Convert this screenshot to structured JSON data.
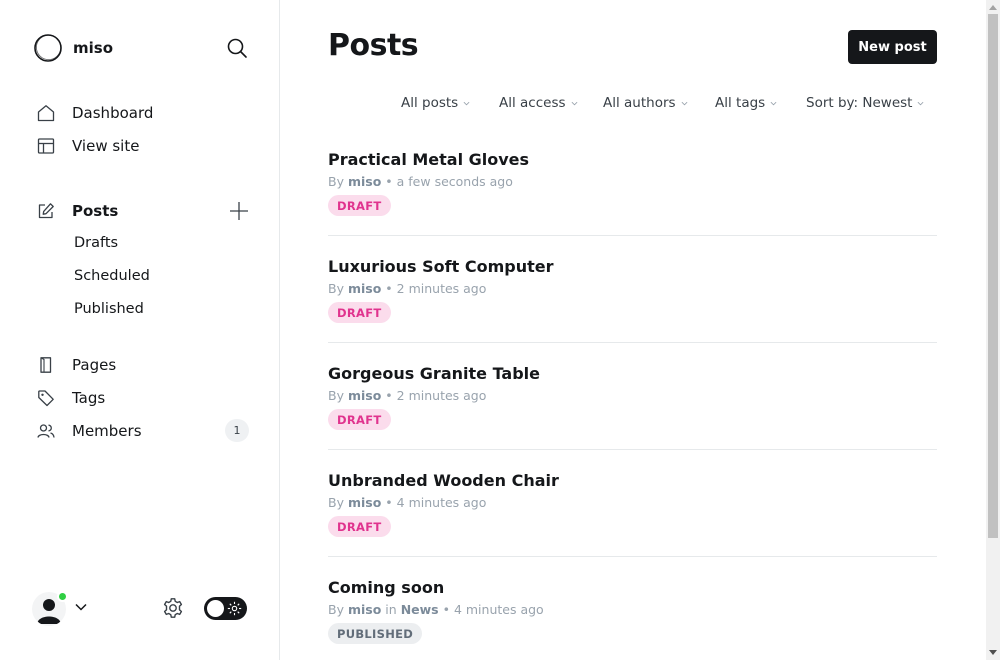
{
  "brand": {
    "name": "miso",
    "logo_icon": "circle-logo-icon"
  },
  "sidebar": {
    "nav": [
      {
        "label": "Dashboard",
        "icon": "home-icon"
      },
      {
        "label": "View site",
        "icon": "layout-icon"
      }
    ],
    "posts": {
      "label": "Posts",
      "icon": "edit-icon",
      "add_icon": "plus-icon",
      "sub_items": [
        {
          "label": "Drafts"
        },
        {
          "label": "Scheduled"
        },
        {
          "label": "Published"
        }
      ]
    },
    "secondary": [
      {
        "label": "Pages",
        "icon": "file-icon"
      },
      {
        "label": "Tags",
        "icon": "tag-icon"
      },
      {
        "label": "Members",
        "icon": "users-icon",
        "count": "1"
      }
    ],
    "footer": {
      "avatar_icon": "user-avatar-icon",
      "settings_icon": "gear-icon",
      "theme_toggle_icon": "sun-icon"
    }
  },
  "main": {
    "title": "Posts",
    "new_post_label": "New post",
    "filters": [
      {
        "label": "All posts"
      },
      {
        "label": "All access"
      },
      {
        "label": "All authors"
      },
      {
        "label": "All tags"
      },
      {
        "label": "Sort by: Newest"
      }
    ],
    "posts": [
      {
        "title": "Practical Metal Gloves",
        "by": "By",
        "author": "miso",
        "in": "",
        "tag": "",
        "time": "• a few seconds ago",
        "status": "DRAFT"
      },
      {
        "title": "Luxurious Soft Computer",
        "by": "By",
        "author": "miso",
        "in": "",
        "tag": "",
        "time": "• 2 minutes ago",
        "status": "DRAFT"
      },
      {
        "title": "Gorgeous Granite Table",
        "by": "By",
        "author": "miso",
        "in": "",
        "tag": "",
        "time": "• 2 minutes ago",
        "status": "DRAFT"
      },
      {
        "title": "Unbranded Wooden Chair",
        "by": "By",
        "author": "miso",
        "in": "",
        "tag": "",
        "time": "• 4 minutes ago",
        "status": "DRAFT"
      },
      {
        "title": "Coming soon",
        "by": "By",
        "author": "miso",
        "in": "in",
        "tag": "News",
        "time": "• 4 minutes ago",
        "status": "PUBLISHED"
      }
    ]
  },
  "colors": {
    "accent": "#15171a",
    "draft_bg": "#fbdcec",
    "draft_text": "#e0338e",
    "published_bg": "#eceef0",
    "published_text": "#626d79",
    "online": "#30cf43"
  }
}
